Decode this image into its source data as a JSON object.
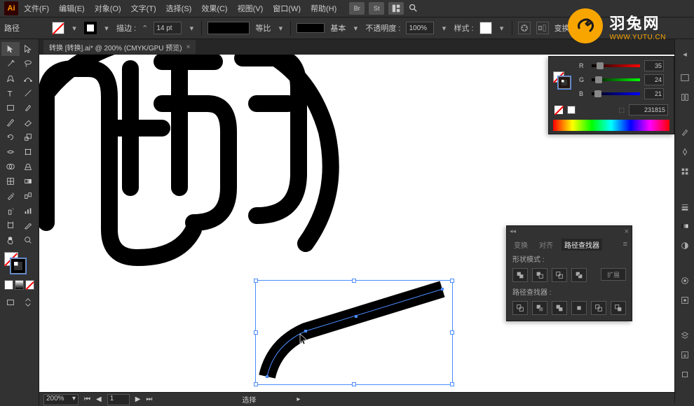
{
  "app": {
    "logo": "Ai"
  },
  "menubar": {
    "file": "文件(F)",
    "edit": "编辑(E)",
    "object": "对象(O)",
    "type": "文字(T)",
    "select": "选择(S)",
    "effect": "效果(C)",
    "view": "视图(V)",
    "window": "窗口(W)",
    "help": "帮助(H)",
    "bridge_btn": "Br",
    "stock_btn": "St"
  },
  "optbar": {
    "label_path": "路径",
    "stroke_label": "描边 :",
    "stroke_pt": "14 pt",
    "profile_label": "等比",
    "style_label": "基本",
    "opacity_label": "不透明度 :",
    "opacity_value": "100%",
    "graphic_style_label": "样式 :",
    "transform_label": "变换"
  },
  "document": {
    "tab_title": "转换  [转换].ai* @ 200% (CMYK/GPU 预览)"
  },
  "color_panel": {
    "r_label": "R",
    "r_value": "35",
    "g_label": "G",
    "g_value": "24",
    "b_label": "B",
    "b_value": "21",
    "hex_value": "231815"
  },
  "pathfinder": {
    "tab_transform": "变换",
    "tab_align": "对齐",
    "tab_pathfinder": "路径查找器",
    "shape_modes": "形状模式 :",
    "pathfinders": "路径查找器 :",
    "expand": "扩展"
  },
  "statusbar": {
    "zoom": "200%",
    "artboard_nav": "1",
    "tool_name": "选择"
  },
  "watermark": {
    "title": "羽兔网",
    "url": "WWW.YUTU.CN"
  }
}
